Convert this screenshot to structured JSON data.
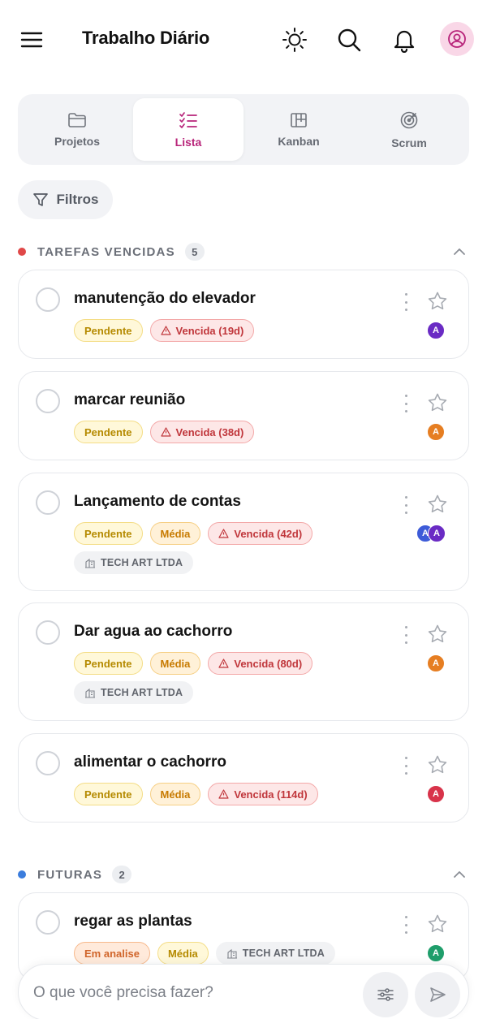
{
  "header": {
    "title": "Trabalho Diário",
    "icons": [
      "menu-icon",
      "sun-icon",
      "search-icon",
      "bell-icon",
      "user-avatar-icon"
    ]
  },
  "tabs": [
    {
      "label": "Projetos",
      "icon": "folder-icon",
      "active": false
    },
    {
      "label": "Lista",
      "icon": "checklist-icon",
      "active": true
    },
    {
      "label": "Kanban",
      "icon": "kanban-icon",
      "active": false
    },
    {
      "label": "Scrum",
      "icon": "target-icon",
      "active": false
    }
  ],
  "filter": {
    "label": "Filtros",
    "icon": "filter-icon"
  },
  "sections": {
    "overdue": {
      "title": "TAREFAS VENCIDAS",
      "count": "5",
      "color": "#e04848",
      "tasks": [
        {
          "title": "manutenção do elevador",
          "status": "Pendente",
          "overdue": "Vencida (19d)",
          "avatars": [
            "A"
          ]
        },
        {
          "title": "marcar reunião",
          "status": "Pendente",
          "overdue": "Vencida (38d)",
          "avatars": [
            "A"
          ]
        },
        {
          "title": "Lançamento de contas",
          "status": "Pendente",
          "priority": "Média",
          "overdue": "Vencida (42d)",
          "company": "TECH ART LTDA",
          "avatars": [
            "A",
            "A"
          ]
        },
        {
          "title": "Dar agua ao cachorro",
          "status": "Pendente",
          "priority": "Média",
          "overdue": "Vencida (80d)",
          "company": "TECH ART LTDA",
          "avatars": [
            "A"
          ]
        },
        {
          "title": "alimentar o cachorro",
          "status": "Pendente",
          "priority": "Média",
          "overdue": "Vencida (114d)",
          "avatars": [
            "A"
          ]
        }
      ]
    },
    "future": {
      "title": "FUTURAS",
      "count": "2",
      "color": "#3b7ddd",
      "tasks": [
        {
          "title": "regar as plantas",
          "status": "Em analise",
          "priority": "Média",
          "company": "TECH ART LTDA",
          "avatars": [
            "A"
          ]
        }
      ]
    }
  },
  "avatar_colors": {
    "purple": "#6a2bc4",
    "orange": "#e67e22",
    "blue": "#3d5bd8",
    "red": "#d8334a",
    "green": "#1f9e6b"
  },
  "composer": {
    "placeholder": "O que você precisa fazer?"
  }
}
